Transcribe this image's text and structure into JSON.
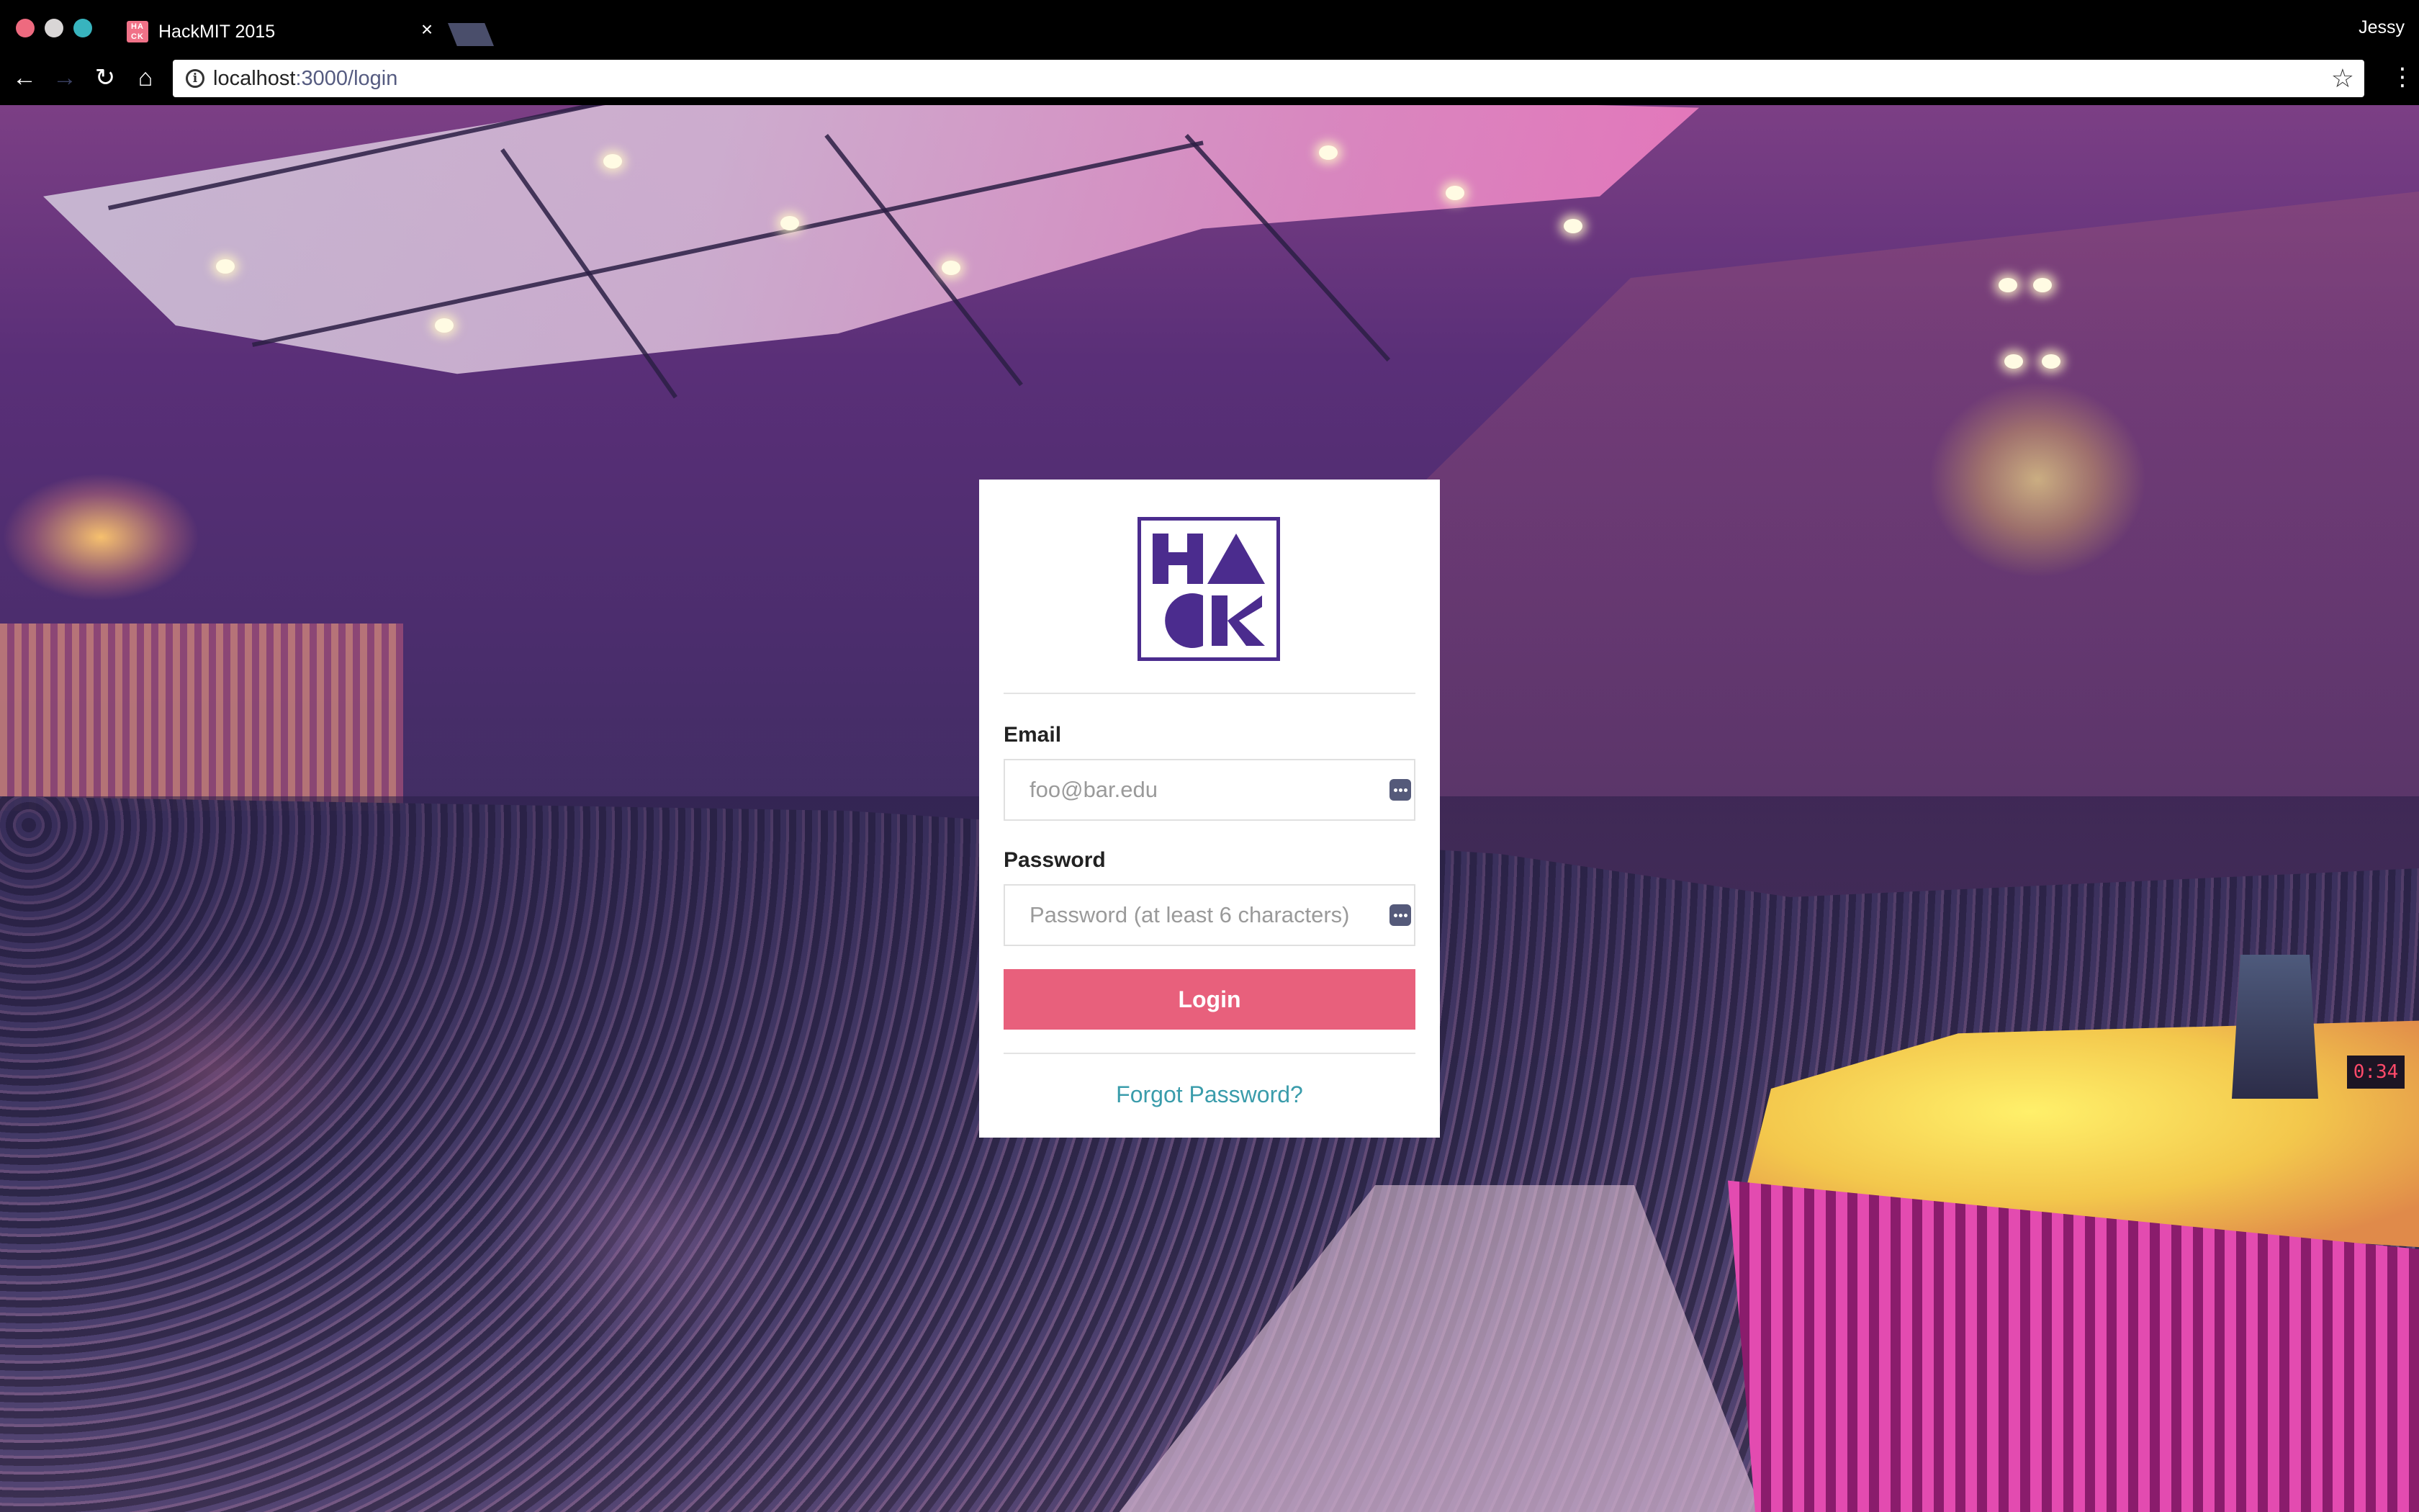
{
  "browser": {
    "tab": {
      "title": "HackMIT 2015",
      "favicon_text": "HA CK",
      "close_glyph": "×"
    },
    "profile_name": "Jessy",
    "address": {
      "host": "localhost",
      "path": ":3000/login"
    },
    "icons": {
      "back": "←",
      "forward": "→",
      "reload": "↻",
      "home": "⌂",
      "info": "i",
      "star": "☆",
      "menu": "⋮"
    }
  },
  "login": {
    "logo": {
      "letters": [
        "H",
        "A",
        "C",
        "K"
      ],
      "color": "#4b2c8e"
    },
    "email": {
      "label": "Email",
      "placeholder": "foo@bar.edu",
      "value": ""
    },
    "password": {
      "label": "Password",
      "placeholder": "Password (at least 6 characters)",
      "value": ""
    },
    "login_button": "Login",
    "forgot_link": "Forgot Password?",
    "timer_display": "0:34"
  },
  "colors": {
    "accent": "#e8607c",
    "link": "#3a9cab",
    "brand": "#4b2c8e"
  }
}
